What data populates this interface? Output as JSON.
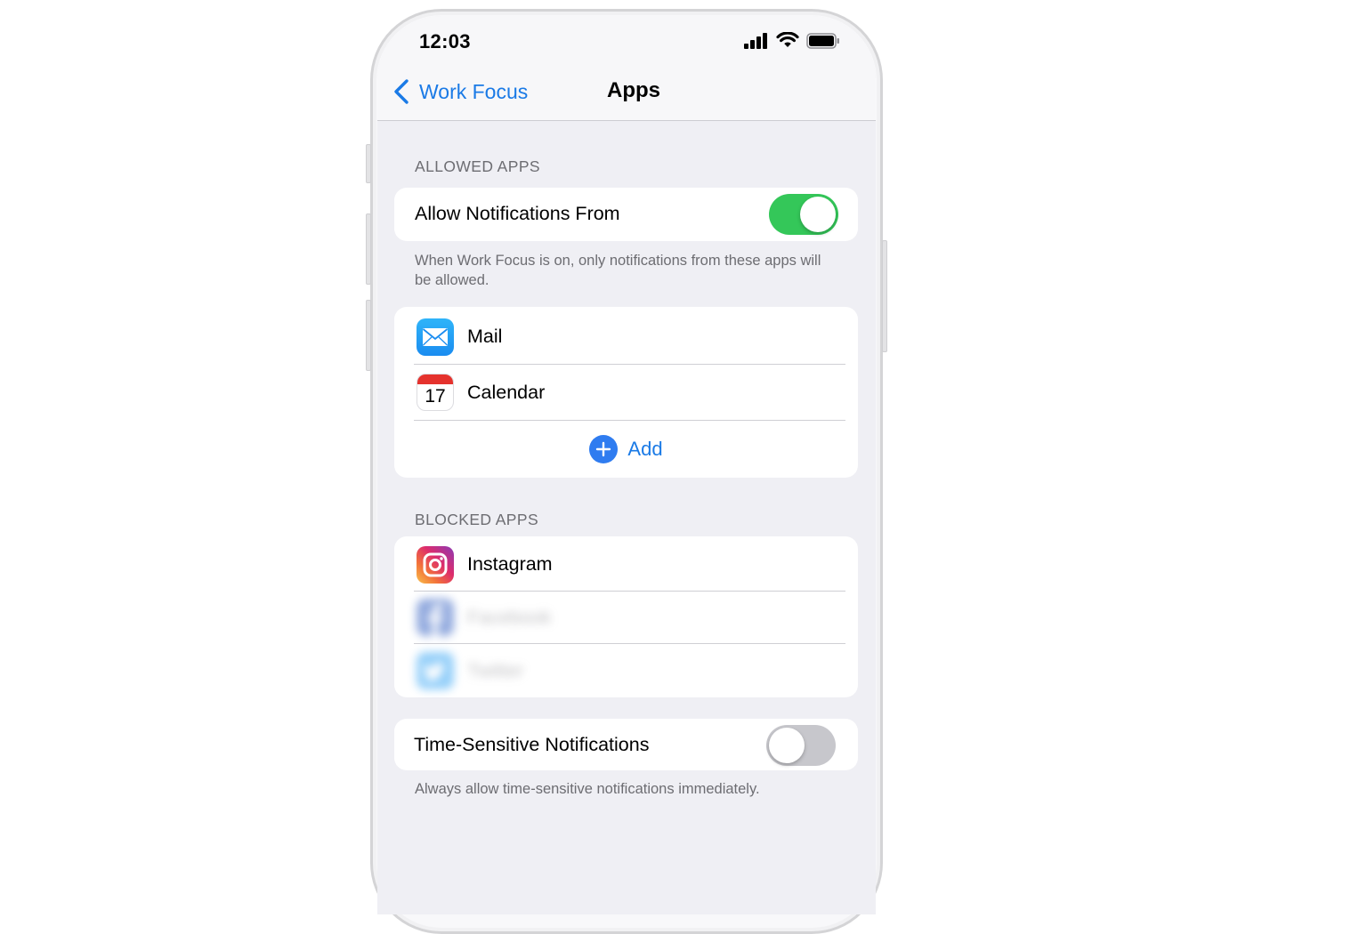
{
  "status_bar": {
    "time": "12:03"
  },
  "nav": {
    "back_label": "Work Focus",
    "title": "Apps"
  },
  "allowed": {
    "header": "ALLOWED APPS",
    "toggle_label": "Allow Notifications From",
    "toggle_on": true,
    "footer": "When Work Focus is on, only notifications from these apps will be allowed.",
    "apps": [
      {
        "name": "Mail",
        "icon": "mail-icon"
      },
      {
        "name": "Calendar",
        "icon": "calendar-icon",
        "day": "17"
      }
    ],
    "add_label": "Add"
  },
  "blocked": {
    "header": "BLOCKED APPS",
    "apps": [
      {
        "name": "Instagram",
        "icon": "instagram-icon"
      },
      {
        "name": "Facebook",
        "icon": "facebook-icon"
      },
      {
        "name": "Twitter",
        "icon": "twitter-icon"
      }
    ]
  },
  "time_sensitive": {
    "label": "Time-Sensitive Notifications",
    "toggle_on": false,
    "footer": "Always allow time-sensitive notifications immediately."
  },
  "colors": {
    "accent": "#1a7ae6",
    "toggle_on": "#34c759",
    "toggle_off": "#c7c7cc",
    "background": "#efeff4"
  }
}
